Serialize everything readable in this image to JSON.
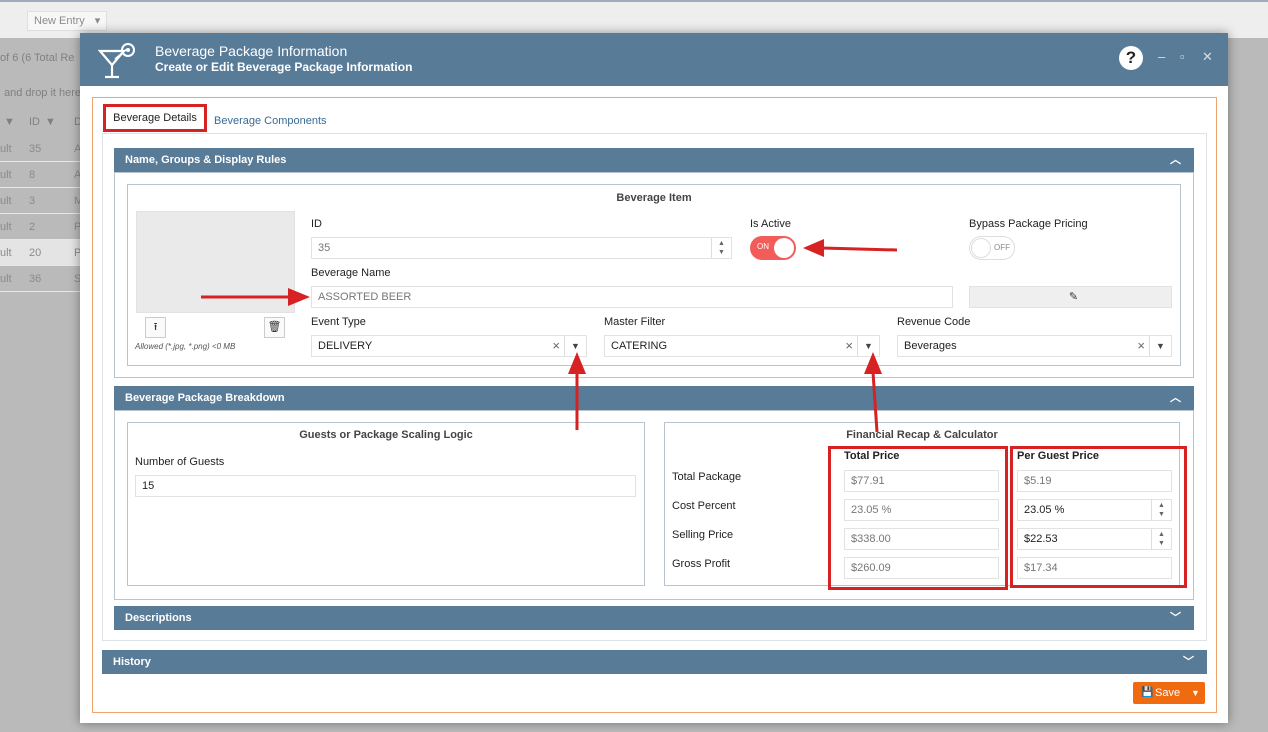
{
  "background": {
    "new_entry_label": "New Entry",
    "records_text": "of 6 (6 Total Re",
    "drop_text": "and drop it here",
    "id_header": "ID",
    "d_header": "D",
    "rows": [
      {
        "c1": "ult",
        "id": "35",
        "c3": "A"
      },
      {
        "c1": "ult",
        "id": "8",
        "c3": "A"
      },
      {
        "c1": "ult",
        "id": "3",
        "c3": "M"
      },
      {
        "c1": "ult",
        "id": "2",
        "c3": "P"
      },
      {
        "c1": "ult",
        "id": "20",
        "c3": "P"
      },
      {
        "c1": "ult",
        "id": "36",
        "c3": "S"
      }
    ]
  },
  "modal": {
    "title": "Beverage Package Information",
    "subtitle": "Create or Edit Beverage Package Information",
    "help": "?"
  },
  "tabs": {
    "details": "Beverage Details",
    "components": "Beverage Components"
  },
  "sections": {
    "name_groups": "Name, Groups & Display Rules",
    "breakdown": "Beverage Package Breakdown",
    "descriptions": "Descriptions",
    "history": "History"
  },
  "item": {
    "box_title": "Beverage Item",
    "allowed": "Allowed (*.jpg, *.png) <0 MB",
    "id_label": "ID",
    "id_value": "35",
    "active_label": "Is Active",
    "active_state": "ON",
    "bypass_label": "Bypass Package Pricing",
    "bypass_state": "OFF",
    "name_label": "Beverage Name",
    "name_value": "ASSORTED BEER",
    "event_label": "Event Type",
    "event_value": "DELIVERY",
    "master_label": "Master Filter",
    "master_value": "CATERING",
    "revenue_label": "Revenue Code",
    "revenue_value": "Beverages"
  },
  "guests": {
    "box_title": "Guests or Package Scaling Logic",
    "label": "Number of Guests",
    "value": "15"
  },
  "financial": {
    "box_title": "Financial Recap & Calculator",
    "total_header": "Total Price",
    "per_header": "Per Guest Price",
    "rows": [
      {
        "label": "Total Package",
        "total": "$77.91",
        "per": "$5.19"
      },
      {
        "label": "Cost Percent",
        "total": "23.05 %",
        "per": "23.05 %"
      },
      {
        "label": "Selling Price",
        "total": "$338.00",
        "per": "$22.53"
      },
      {
        "label": "Gross Profit",
        "total": "$260.09",
        "per": "$17.34"
      }
    ]
  },
  "save_label": "Save",
  "colors": {
    "header": "#587b98",
    "annotation_red": "#d62222",
    "save_orange": "#f06a0f",
    "toggle_on": "#f25c5a"
  }
}
